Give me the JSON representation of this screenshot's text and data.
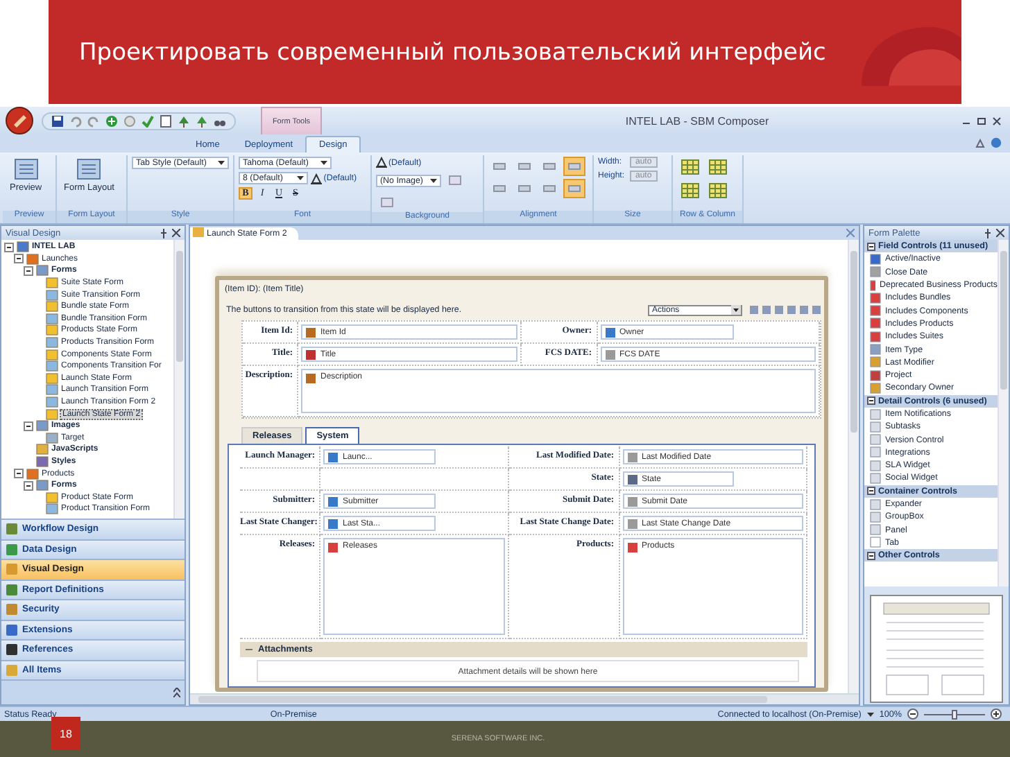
{
  "slide": {
    "title": "Проектировать современный пользовательский интерфейс",
    "page_number": "18",
    "footer": "SERENA SOFTWARE INC."
  },
  "window": {
    "title": "INTEL LAB - SBM Composer",
    "contextual_tab": "Form Tools"
  },
  "ribbon_tabs": [
    {
      "label": "Home",
      "selected": false
    },
    {
      "label": "Deployment",
      "selected": false
    },
    {
      "label": "Design",
      "selected": true
    }
  ],
  "ribbon_groups": [
    {
      "label": "Preview",
      "controls": [
        {
          "kind": "big",
          "label": "Preview"
        }
      ]
    },
    {
      "label": "Form Layout",
      "controls": [
        {
          "kind": "big",
          "label": "Form Layout"
        }
      ]
    },
    {
      "label": "Style",
      "controls": [
        {
          "kind": "dropdown",
          "value": "Tab Style (Default)"
        }
      ]
    },
    {
      "label": "Font",
      "controls": [
        {
          "kind": "dropdown",
          "value": "Tahoma (Default)"
        },
        {
          "kind": "dropdown",
          "value": "8 (Default)"
        },
        {
          "kind": "color",
          "label": "(Default)"
        },
        {
          "kind": "format",
          "label": "B",
          "selected": true
        },
        {
          "kind": "format",
          "label": "I",
          "selected": false
        },
        {
          "kind": "format",
          "label": "U",
          "selected": false
        },
        {
          "kind": "format",
          "label": "S",
          "selected": false
        }
      ]
    },
    {
      "label": "Background",
      "controls": [
        {
          "kind": "color",
          "label": "(Default)"
        },
        {
          "kind": "dropdown",
          "value": "(No Image)"
        },
        {
          "kind": "tool",
          "selected": false
        },
        {
          "kind": "tool",
          "selected": false
        }
      ]
    },
    {
      "label": "Alignment",
      "controls": [
        {
          "kind": "align",
          "selected": false
        },
        {
          "kind": "align",
          "selected": false
        },
        {
          "kind": "align",
          "selected": false
        },
        {
          "kind": "align",
          "selected": true
        },
        {
          "kind": "align",
          "selected": false
        },
        {
          "kind": "align",
          "selected": false
        },
        {
          "kind": "align",
          "selected": false
        },
        {
          "kind": "align",
          "selected": true
        }
      ]
    },
    {
      "label": "Size",
      "controls": [
        {
          "kind": "size",
          "label": "Width:",
          "value": "auto",
          "disabled": true
        },
        {
          "kind": "size",
          "label": "Height:",
          "value": "auto",
          "disabled": true
        }
      ]
    },
    {
      "label": "Row & Column",
      "controls": [
        {
          "kind": "table",
          "selected": false
        },
        {
          "kind": "table",
          "selected": false
        },
        {
          "kind": "table",
          "selected": false
        },
        {
          "kind": "table",
          "selected": false
        }
      ]
    }
  ],
  "visual_design": {
    "title": "Visual Design",
    "tree": [
      {
        "label": "INTEL LAB",
        "kind": "root",
        "expanded": true,
        "selected": false,
        "children": [
          {
            "label": "Launches",
            "kind": "app",
            "expanded": true,
            "selected": false,
            "children": [
              {
                "label": "Forms",
                "kind": "folder",
                "expanded": true,
                "selected": false,
                "children": [
                  {
                    "label": "Suite State Form",
                    "kind": "state-form",
                    "selected": false
                  },
                  {
                    "label": "Suite Transition Form",
                    "kind": "transition-form",
                    "selected": false
                  },
                  {
                    "label": "Bundle state Form",
                    "kind": "state-form",
                    "selected": false
                  },
                  {
                    "label": "Bundle Transition Form",
                    "kind": "transition-form",
                    "selected": false
                  },
                  {
                    "label": "Products State Form",
                    "kind": "state-form",
                    "selected": false
                  },
                  {
                    "label": "Products Transition Form",
                    "kind": "transition-form",
                    "selected": false
                  },
                  {
                    "label": "Components State Form",
                    "kind": "state-form",
                    "selected": false
                  },
                  {
                    "label": "Components Transition For",
                    "kind": "transition-form",
                    "selected": false
                  },
                  {
                    "label": "Launch State Form",
                    "kind": "state-form",
                    "selected": false
                  },
                  {
                    "label": "Launch Transition Form",
                    "kind": "transition-form",
                    "selected": false
                  },
                  {
                    "label": "Launch Transition Form 2",
                    "kind": "transition-form",
                    "selected": false
                  },
                  {
                    "label": "Launch State Form 2",
                    "kind": "state-form",
                    "selected": true
                  }
                ]
              },
              {
                "label": "Images",
                "kind": "folder",
                "expanded": true,
                "selected": false,
                "children": [
                  {
                    "label": "Target",
                    "kind": "image",
                    "selected": false
                  }
                ]
              },
              {
                "label": "JavaScripts",
                "kind": "script",
                "selected": false
              },
              {
                "label": "Styles",
                "kind": "style",
                "selected": false
              }
            ]
          },
          {
            "label": "Products",
            "kind": "app",
            "expanded": true,
            "selected": false,
            "children": [
              {
                "label": "Forms",
                "kind": "folder",
                "expanded": true,
                "selected": false,
                "children": [
                  {
                    "label": "Product State Form",
                    "kind": "state-form",
                    "selected": false
                  },
                  {
                    "label": "Product Transition Form",
                    "kind": "transition-form",
                    "selected": false
                  }
                ]
              }
            ]
          }
        ]
      }
    ]
  },
  "navigation": [
    {
      "label": "Workflow Design",
      "selected": false,
      "color": "#6a8a3a"
    },
    {
      "label": "Data Design",
      "selected": false,
      "color": "#3a9a4a"
    },
    {
      "label": "Visual Design",
      "selected": true,
      "color": "#d89a30"
    },
    {
      "label": "Report Definitions",
      "selected": false,
      "color": "#4a8a3a"
    },
    {
      "label": "Security",
      "selected": false,
      "color": "#c08a30"
    },
    {
      "label": "Extensions",
      "selected": false,
      "color": "#3a6ac8"
    },
    {
      "label": "References",
      "selected": false,
      "color": "#303030"
    },
    {
      "label": "All Items",
      "selected": false,
      "color": "#d8a838"
    }
  ],
  "document_tab": "Launch State Form 2",
  "form": {
    "header": "(Item ID): (Item Title)",
    "transition_note": "The buttons to transition from this state will be displayed here.",
    "actions": "Actions",
    "top_rows": [
      {
        "left": {
          "label": "Item Id:",
          "value": "Item Id",
          "kind": "text"
        },
        "right": {
          "label": "Owner:",
          "value": "Owner",
          "kind": "user"
        }
      },
      {
        "left": {
          "label": "Title:",
          "value": "Title",
          "kind": "title"
        },
        "right": {
          "label": "FCS DATE:",
          "value": "FCS DATE",
          "kind": "date"
        }
      },
      {
        "left": {
          "label": "Description:",
          "value": "Description",
          "kind": "textarea"
        }
      }
    ],
    "tabs": [
      {
        "label": "Releases",
        "selected": false
      },
      {
        "label": "System",
        "selected": true
      }
    ],
    "system_rows": [
      {
        "left": {
          "label": "Launch Manager:",
          "value": "Launc...",
          "kind": "user"
        },
        "right": {
          "label": "Last Modified Date:",
          "value": "Last Modified Date",
          "kind": "date"
        }
      },
      {
        "right": {
          "label": "State:",
          "value": "State",
          "kind": "select"
        }
      },
      {
        "left": {
          "label": "Submitter:",
          "value": "Submitter",
          "kind": "user"
        },
        "right": {
          "label": "Submit Date:",
          "value": "Submit Date",
          "kind": "date"
        }
      },
      {
        "left": {
          "label": "Last State Changer:",
          "value": "Last Sta...",
          "kind": "user"
        },
        "right": {
          "label": "Last State Change Date:",
          "value": "Last State Change Date",
          "kind": "date"
        }
      },
      {
        "left": {
          "label": "Releases:",
          "value": "Releases",
          "kind": "relation"
        },
        "right": {
          "label": "Products:",
          "value": "Products",
          "kind": "relation"
        }
      }
    ],
    "attachments": {
      "title": "Attachments",
      "note": "Attachment details will be shown here"
    }
  },
  "form_palette": {
    "title": "Form Palette",
    "sections": [
      {
        "title": "Field Controls (11 unused)",
        "items": [
          {
            "label": "Active/Inactive",
            "kind": "toggle"
          },
          {
            "label": "Close Date",
            "kind": "date"
          },
          {
            "label": "Deprecated Business Products",
            "kind": "relation"
          },
          {
            "label": "Includes Bundles",
            "kind": "relation"
          },
          {
            "label": "Includes Components",
            "kind": "relation"
          },
          {
            "label": "Includes Products",
            "kind": "relation"
          },
          {
            "label": "Includes Suites",
            "kind": "relation"
          },
          {
            "label": "Item Type",
            "kind": "type"
          },
          {
            "label": "Last Modifier",
            "kind": "user"
          },
          {
            "label": "Project",
            "kind": "project"
          },
          {
            "label": "Secondary Owner",
            "kind": "user"
          }
        ]
      },
      {
        "title": "Detail Controls (6 unused)",
        "items": [
          {
            "label": "Item Notifications",
            "kind": "control"
          },
          {
            "label": "Subtasks",
            "kind": "control"
          },
          {
            "label": "Version Control",
            "kind": "control"
          },
          {
            "label": "Integrations",
            "kind": "control"
          },
          {
            "label": "SLA Widget",
            "kind": "control"
          },
          {
            "label": "Social Widget",
            "kind": "control"
          }
        ]
      },
      {
        "title": "Container Controls",
        "items": [
          {
            "label": "Expander",
            "kind": "control"
          },
          {
            "label": "GroupBox",
            "kind": "control"
          },
          {
            "label": "Panel",
            "kind": "control"
          },
          {
            "label": "Tab",
            "kind": "tab"
          }
        ]
      },
      {
        "title": "Other Controls"
      }
    ]
  },
  "status_bar": {
    "status": "Status Ready",
    "mode": "On-Premise",
    "connection": "Connected to localhost (On-Premise)",
    "zoom": "100%",
    "zoom_slider": {
      "level": 0.5
    }
  }
}
